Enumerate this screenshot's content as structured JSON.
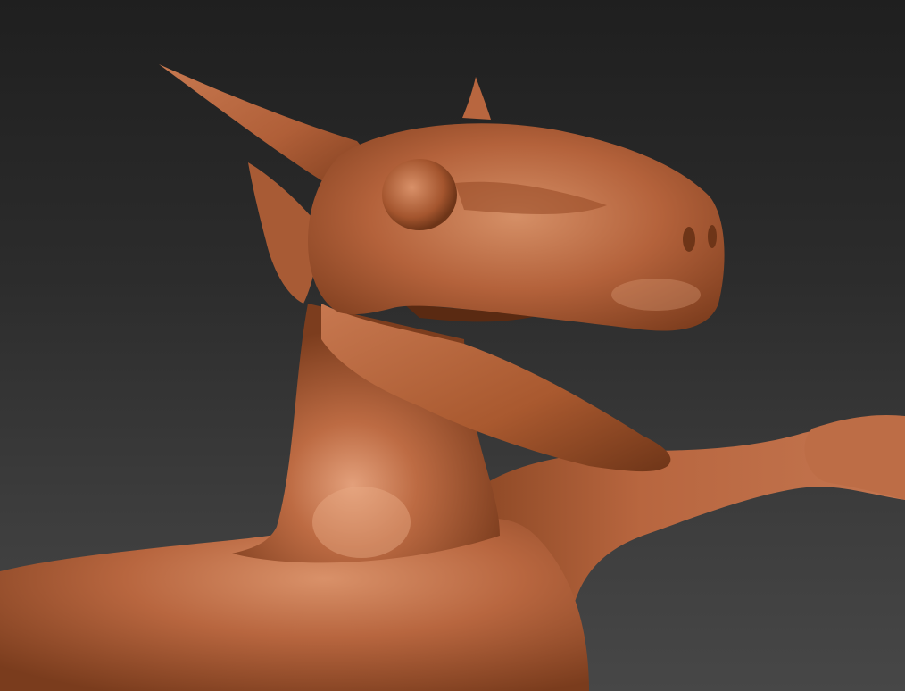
{
  "viewport": {
    "background_top": "#1f1f1f",
    "background_bottom": "#474747"
  },
  "model": {
    "material_color": "#b8663f",
    "highlight_color": "#e0a17a",
    "shadow_color": "#6e3518",
    "parts": [
      "body",
      "neck",
      "head",
      "horn",
      "ear",
      "jaw",
      "eye-ridge",
      "nostril",
      "arm",
      "hand",
      "back-spike"
    ]
  }
}
